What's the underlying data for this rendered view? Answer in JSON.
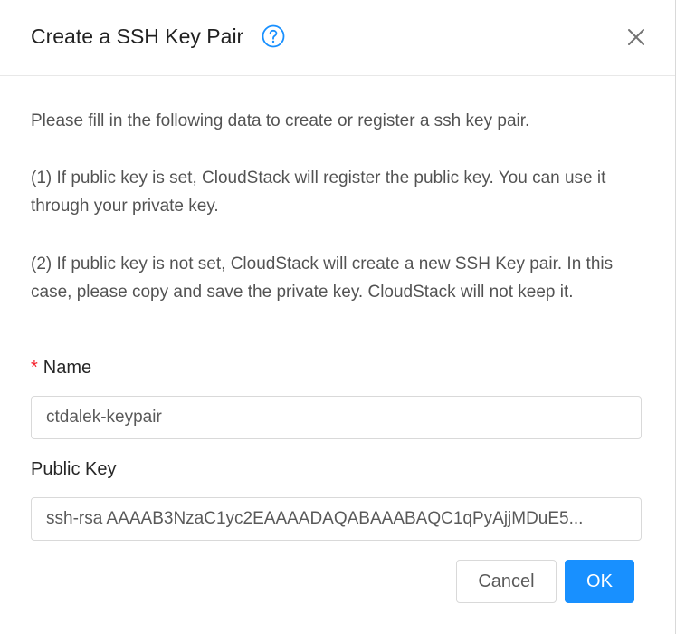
{
  "dialog": {
    "title": "Create a SSH Key Pair",
    "help_icon": "question-circle-icon",
    "close_icon": "close-icon"
  },
  "description": {
    "p1": "Please fill in the following data to create or register a ssh key pair.",
    "p2": "(1) If public key is set, CloudStack will register the public key. You can use it through your private key.",
    "p3": "(2) If public key is not set, CloudStack will create a new SSH Key pair. In this case, please copy and save the private key. CloudStack will not keep it."
  },
  "form": {
    "name": {
      "required_mark": "*",
      "label": "Name",
      "value": "ctdalek-keypair"
    },
    "public_key": {
      "label": "Public Key",
      "value": "ssh-rsa AAAAB3NzaC1yc2EAAAADAQABAAABAQC1qPyAjjMDuE5..."
    }
  },
  "footer": {
    "cancel_label": "Cancel",
    "ok_label": "OK"
  },
  "colors": {
    "primary": "#1890ff",
    "required": "#f5222d"
  }
}
